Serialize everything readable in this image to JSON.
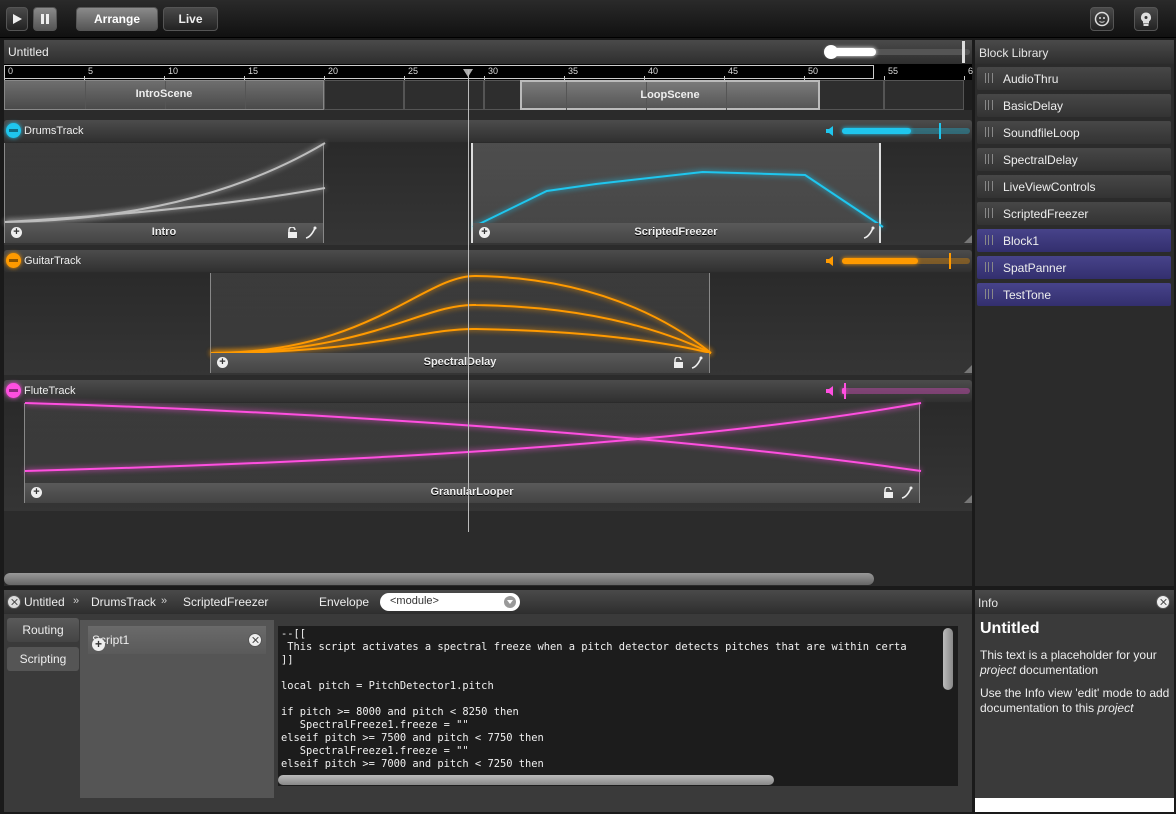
{
  "toolbar": {
    "arrange_label": "Arrange",
    "live_label": "Live"
  },
  "project": {
    "title": "Untitled",
    "zoom": 0.5
  },
  "ruler": {
    "ticks": [
      "0",
      "5",
      "10",
      "15",
      "20",
      "25",
      "30",
      "35",
      "40",
      "45",
      "50",
      "55",
      "6"
    ]
  },
  "scenes": [
    {
      "name": "IntroScene",
      "selected": false
    },
    {
      "name": "LoopScene",
      "selected": true
    }
  ],
  "tracks": [
    {
      "name": "DrumsTrack",
      "color": "#1fc6ee",
      "volume": 0.77,
      "blocks": [
        {
          "name": "Intro",
          "selected": false
        },
        {
          "name": "ScriptedFreezer",
          "selected": true
        }
      ]
    },
    {
      "name": "GuitarTrack",
      "color": "#ff9a00",
      "volume": 0.85,
      "blocks": [
        {
          "name": "SpectralDelay",
          "selected": false
        }
      ]
    },
    {
      "name": "FluteTrack",
      "color": "#ff4fe0",
      "volume": 0.03,
      "blocks": [
        {
          "name": "GranularLooper",
          "selected": false
        }
      ]
    }
  ],
  "library": {
    "title": "Block Library",
    "items": [
      {
        "label": "AudioThru",
        "user": false
      },
      {
        "label": "BasicDelay",
        "user": false
      },
      {
        "label": "SoundfileLoop",
        "user": false
      },
      {
        "label": "SpectralDelay",
        "user": false
      },
      {
        "label": "LiveViewControls",
        "user": false
      },
      {
        "label": "ScriptedFreezer",
        "user": false
      },
      {
        "label": "Block1",
        "user": true
      },
      {
        "label": "SpatPanner",
        "user": true
      },
      {
        "label": "TestTone",
        "user": true
      }
    ]
  },
  "editor": {
    "crumbs": [
      "Untitled",
      "DrumsTrack",
      "ScriptedFreezer"
    ],
    "crumb_sep": "»",
    "envelope_label": "Envelope",
    "envelope_value": "<module>",
    "tabs": [
      "Routing",
      "Scripting"
    ],
    "active_tab": "Scripting",
    "script_name": "Script1",
    "code": [
      "--[[",
      " This script activates a spectral freeze when a pitch detector detects pitches that are within certa",
      "]]",
      "",
      "local pitch = PitchDetector1.pitch",
      "",
      "if pitch >= 8000 and pitch < 8250 then",
      "   SpectralFreeze1.freeze = \"\"",
      "elseif pitch >= 7500 and pitch < 7750 then",
      "   SpectralFreeze1.freeze = \"\"",
      "elseif pitch >= 7000 and pitch < 7250 then"
    ]
  },
  "info": {
    "header": "Info",
    "title": "Untitled",
    "para1_a": "This text is a placeholder for your ",
    "para1_em": "project",
    "para1_b": " documentation",
    "para2_a": "Use the Info view 'edit' mode to add documentation to this ",
    "para2_em": "project"
  }
}
